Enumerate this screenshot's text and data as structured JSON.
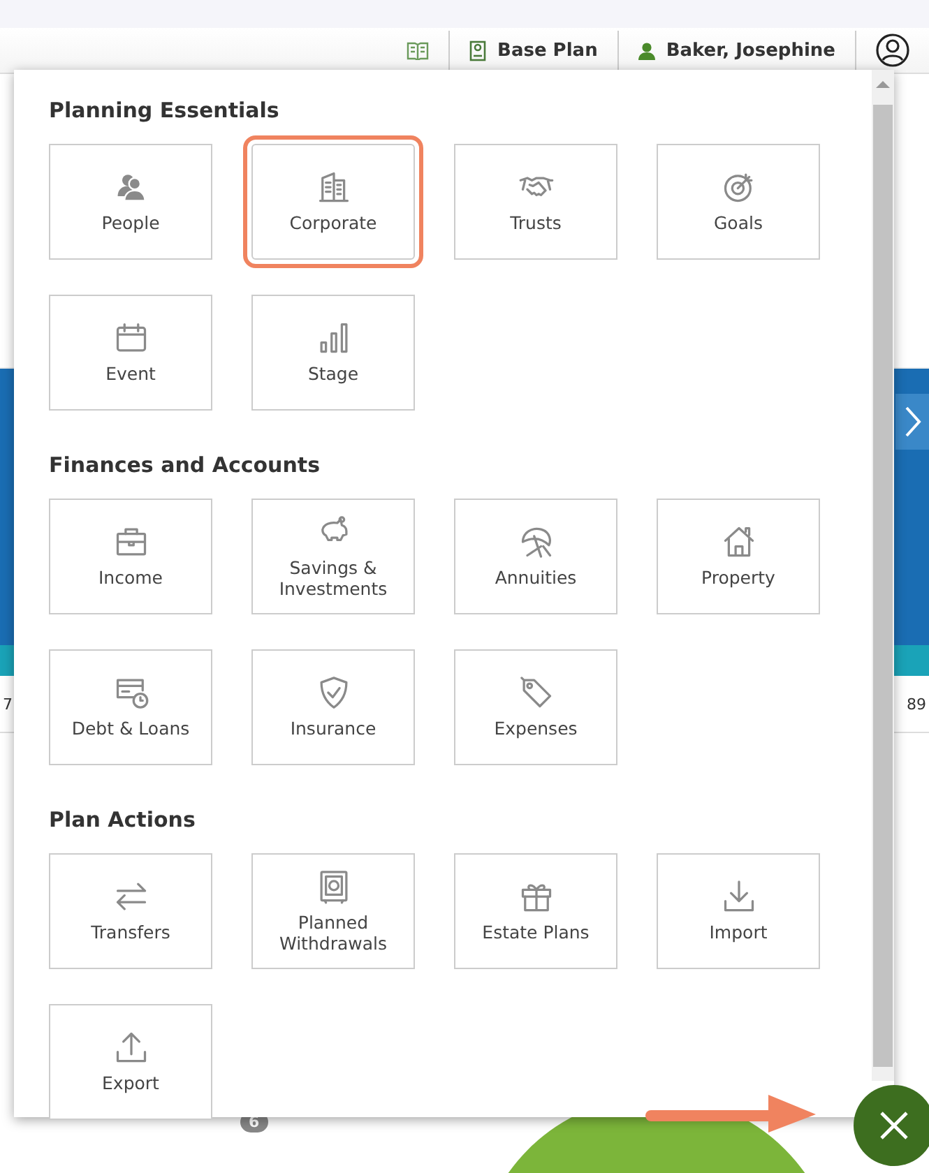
{
  "header": {
    "plan_label": "Base Plan",
    "user_name": "Baker, Josephine"
  },
  "background": {
    "left_value": "7",
    "right_value": "89",
    "badge": "6"
  },
  "menu": {
    "sections": [
      {
        "title": "Planning Essentials",
        "items": [
          {
            "label": "People",
            "kind": "people",
            "highlighted": false
          },
          {
            "label": "Corporate",
            "kind": "building",
            "highlighted": true
          },
          {
            "label": "Trusts",
            "kind": "handshake",
            "highlighted": false
          },
          {
            "label": "Goals",
            "kind": "target",
            "highlighted": false
          },
          {
            "label": "Event",
            "kind": "calendar",
            "highlighted": false
          },
          {
            "label": "Stage",
            "kind": "bars",
            "highlighted": false
          }
        ]
      },
      {
        "title": "Finances and Accounts",
        "items": [
          {
            "label": "Income",
            "kind": "briefcase",
            "highlighted": false
          },
          {
            "label": "Savings & Investments",
            "kind": "piggy",
            "highlighted": false
          },
          {
            "label": "Annuities",
            "kind": "umbrella",
            "highlighted": false
          },
          {
            "label": "Property",
            "kind": "house",
            "highlighted": false
          },
          {
            "label": "Debt & Loans",
            "kind": "card",
            "highlighted": false
          },
          {
            "label": "Insurance",
            "kind": "shield",
            "highlighted": false
          },
          {
            "label": "Expenses",
            "kind": "tag",
            "highlighted": false
          }
        ]
      },
      {
        "title": "Plan Actions",
        "items": [
          {
            "label": "Transfers",
            "kind": "transfer",
            "highlighted": false
          },
          {
            "label": "Planned Withdrawals",
            "kind": "safe",
            "highlighted": false
          },
          {
            "label": "Estate Plans",
            "kind": "gift",
            "highlighted": false
          },
          {
            "label": "Import",
            "kind": "download",
            "highlighted": false
          },
          {
            "label": "Export",
            "kind": "upload",
            "highlighted": false
          }
        ]
      }
    ]
  }
}
